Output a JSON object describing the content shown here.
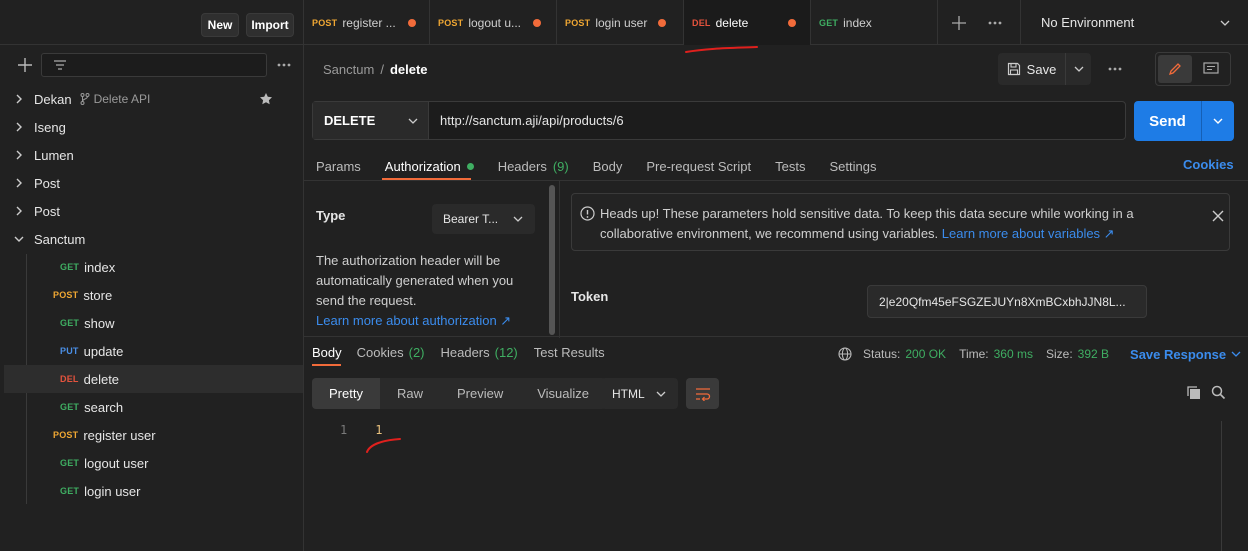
{
  "sidebar": {
    "new_label": "New",
    "import_label": "Import",
    "items": [
      {
        "name": "Dekan",
        "meta": "Delete API"
      },
      {
        "name": "Iseng"
      },
      {
        "name": "Lumen"
      },
      {
        "name": "Post"
      },
      {
        "name": "Post"
      },
      {
        "name": "Sanctum"
      }
    ],
    "requests": [
      {
        "method": "GET",
        "name": "index"
      },
      {
        "method": "POST",
        "name": "store"
      },
      {
        "method": "GET",
        "name": "show"
      },
      {
        "method": "PUT",
        "name": "update"
      },
      {
        "method": "DEL",
        "name": "delete"
      },
      {
        "method": "GET",
        "name": "search"
      },
      {
        "method": "POST",
        "name": "register user"
      },
      {
        "method": "GET",
        "name": "logout user"
      },
      {
        "method": "GET",
        "name": "login user"
      }
    ]
  },
  "tabs": [
    {
      "method": "POST",
      "name": "register ..."
    },
    {
      "method": "POST",
      "name": "logout u..."
    },
    {
      "method": "POST",
      "name": "login user"
    },
    {
      "method": "DEL",
      "name": "delete"
    },
    {
      "method": "GET",
      "name": "index"
    }
  ],
  "environment": "No Environment",
  "breadcrumb": {
    "collection": "Sanctum",
    "sep": "/",
    "request": "delete"
  },
  "save_label": "Save",
  "request": {
    "method": "DELETE",
    "url": "http://sanctum.aji/api/products/6",
    "send_label": "Send"
  },
  "req_tabs": {
    "params": "Params",
    "authorization": "Authorization",
    "headers": "Headers",
    "headers_count": "(9)",
    "body": "Body",
    "prerequest": "Pre-request Script",
    "tests": "Tests",
    "settings": "Settings",
    "cookies": "Cookies"
  },
  "auth": {
    "type_label": "Type",
    "type_value": "Bearer T...",
    "description": "The authorization header will be automatically generated when you send the request.",
    "learn_link": "Learn more about authorization ↗",
    "warning": "Heads up! These parameters hold sensitive data. To keep this data secure while working in a collaborative environment, we recommend using variables.",
    "warning_link": "Learn more about variables ↗",
    "token_label": "Token",
    "token_value": "2|e20Qfm45eFSGZEJUYn8XmBCxbhJJN8L..."
  },
  "response": {
    "tabs": {
      "body": "Body",
      "cookies": "Cookies",
      "cookies_count": "(2)",
      "headers": "Headers",
      "headers_count": "(12)",
      "tests": "Test Results"
    },
    "status_label": "Status:",
    "status_value": "200 OK",
    "time_label": "Time:",
    "time_value": "360 ms",
    "size_label": "Size:",
    "size_value": "392 B",
    "save_label": "Save Response",
    "formats": [
      "Pretty",
      "Raw",
      "Preview",
      "Visualize"
    ],
    "language": "HTML",
    "line_number": "1",
    "line_content": "1"
  },
  "colors": {
    "accent": "#f26b3a",
    "send": "#1e7ce6",
    "get": "#3fae62",
    "post": "#f0a733",
    "put": "#4a8fe6",
    "del": "#e5533d"
  }
}
